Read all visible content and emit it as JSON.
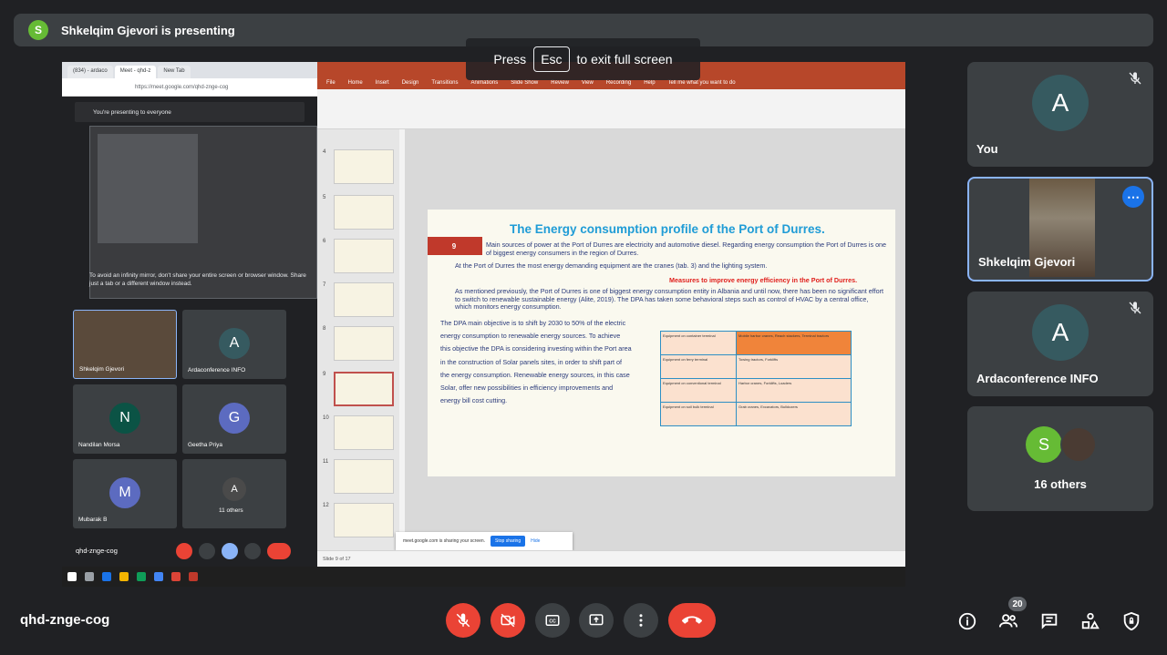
{
  "topbar": {
    "avatar_letter": "S",
    "presenter_text": "Shkelqim Gjevori is presenting"
  },
  "esc_hint": {
    "prefix": "Press",
    "key": "Esc",
    "suffix": "to exit full screen"
  },
  "shared_screen": {
    "browser": {
      "tabs": [
        "(834) - ardaco",
        "Meet - qhd-z",
        "New Tab"
      ],
      "url": "https://meet.google.com/qhd-znge-cog",
      "presenting_banner": "You're presenting to everyone",
      "infinity_msg": "To avoid an infinity mirror, don't share your entire screen or browser window. Share just a tab or a different window instead.",
      "tiles": [
        {
          "name": "Shkelqim Gjevori",
          "letter": "",
          "color": "#5a4a3b"
        },
        {
          "name": "Ardaconference INFO",
          "letter": "A",
          "color": "#365a60"
        },
        {
          "name": "Nandilan Morsa",
          "letter": "N",
          "color": "#0b5345"
        },
        {
          "name": "Geetha Priya",
          "letter": "G",
          "color": "#5c6bc0"
        },
        {
          "name": "Mubarak B",
          "letter": "M",
          "color": "#5c6bc0"
        },
        {
          "name": "11 others",
          "letter": "A",
          "color": "#4a4a4a"
        }
      ],
      "meeting_code": "qhd-znge-cog"
    },
    "ppt": {
      "menu": [
        "File",
        "Home",
        "Insert",
        "Design",
        "Transitions",
        "Animations",
        "Slide Show",
        "Review",
        "View",
        "Recording",
        "Help",
        "Tell me what you want to do"
      ],
      "thumb_numbers": [
        "4",
        "5",
        "6",
        "7",
        "8",
        "9",
        "10",
        "11",
        "12"
      ],
      "slide": {
        "number": "9",
        "title": "The Energy consumption profile of the Port of Durres.",
        "para1": "Main sources of power at the Port of Durres are electricity and automotive diesel. Regarding energy consumption the Port of Durres is one of biggest energy consumers in the region of Durres.",
        "para2": "At the Port of Durres the most energy demanding equipment are the cranes (tab. 3) and the lighting system.",
        "red_heading": "Measures to improve energy efficiency in the Port of Durres.",
        "para3": "As mentioned previously, the Port of Durres is one of biggest energy consumption entity in Albania and until now, there has been no significant effort to switch to renewable sustainable energy (Alite, 2019). The DPA has taken some behavioral steps such as control of HVAC by a central office, which monitors energy consumption.",
        "left_text": "The DPA main objective is to shift by 2030 to 50% of the electric energy consumption to renewable energy sources. To achieve this objective the DPA is considering investing within the Port area in the construction of Solar panels sites, in order to shift part of the energy consumption. Renewable energy sources, in this case Solar, offer new possibilities in efficiency improvements and energy bill cost cutting.",
        "table": [
          [
            "Equipment on container terminal",
            "Mobile harbor cranes, Reach stackers, Terminal tractors"
          ],
          [
            "Equipment on ferry terminal",
            "Towing tractors, Forklifts"
          ],
          [
            "Equipment on conventional terminal",
            "Harbor cranes, Forklifts, Loaders"
          ],
          [
            "Equipment on soil bulk terminal",
            "Grab cranes, Excavators, Bulldozers"
          ]
        ]
      },
      "share_popup": {
        "text": "meet.google.com is sharing your screen.",
        "stop": "Stop sharing",
        "hide": "Hide"
      },
      "status": "Slide 9 of 17"
    }
  },
  "participants": [
    {
      "name": "You",
      "letter": "A"
    },
    {
      "name": "Shkelqim Gjevori",
      "letter": ""
    },
    {
      "name": "Ardaconference INFO",
      "letter": "A"
    }
  ],
  "others": {
    "letter": "S",
    "label": "16 others"
  },
  "bottom": {
    "meeting_code": "qhd-znge-cog",
    "people_count": "20"
  },
  "colors": {
    "accent": "#1a73e8",
    "danger": "#ea4335",
    "tile": "#3c4043",
    "bg": "#202124"
  }
}
